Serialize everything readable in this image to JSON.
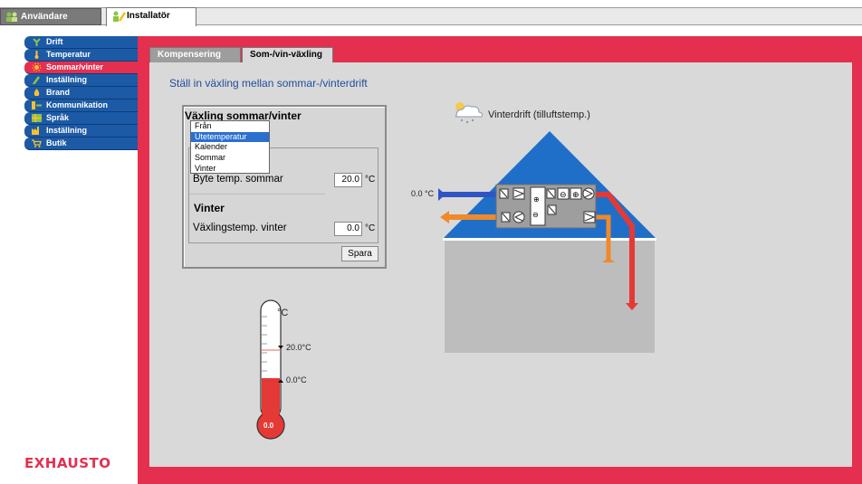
{
  "top_tabs": [
    {
      "label": "Användare",
      "active": false
    },
    {
      "label": "Installatör",
      "active": true
    }
  ],
  "nav": {
    "items": [
      {
        "label": "Drift",
        "icon": "fan-icon",
        "active": false
      },
      {
        "label": "Temperatur",
        "icon": "thermometer-icon",
        "active": false
      },
      {
        "label": "Sommar/vinter",
        "icon": "sun-icon",
        "active": true
      },
      {
        "label": "Inställning",
        "icon": "wrench-icon",
        "active": false
      },
      {
        "label": "Brand",
        "icon": "flame-icon",
        "active": false
      },
      {
        "label": "Kommunikation",
        "icon": "network-icon",
        "active": false
      },
      {
        "label": "Språk",
        "icon": "flag-icon",
        "active": false
      },
      {
        "label": "Inställning",
        "icon": "factory-icon",
        "active": false
      },
      {
        "label": "Butik",
        "icon": "cart-icon",
        "active": false
      }
    ]
  },
  "brand": "EXHAUSTO",
  "content_tabs": [
    {
      "label": "Kompensering",
      "active": false
    },
    {
      "label": "Som-/vin-växling",
      "active": true
    }
  ],
  "heading": "Ställ in växling mellan sommar-/vinterdrift",
  "panel": {
    "title": "Växling sommar/vinter",
    "dropdown_options": [
      "Från",
      "Utetemperatur",
      "Kalender",
      "Sommar",
      "Vinter"
    ],
    "dropdown_selected": "Utetemperatur",
    "summer_label": "Byte temp. sommar",
    "summer_value": "20.0",
    "winter_heading": "Vinter",
    "winter_label": "Växlingstemp. vinter",
    "winter_value": "0.0",
    "unit": "°C",
    "save_label": "Spara"
  },
  "diagram": {
    "mode_label": "Vinterdrift (tilluftstemp.)",
    "outdoor_temp": "0.0 °C"
  },
  "thermometer": {
    "unit": "°C",
    "summer_mark": "20.0°C",
    "winter_mark": "0.0°C",
    "current": "0.0"
  },
  "colors": {
    "accent_red": "#e52f4e",
    "nav_blue": "#1c5aa6",
    "roof_blue": "#1f6fc9",
    "supply_red": "#e53935",
    "extract_orange": "#f0892a"
  }
}
